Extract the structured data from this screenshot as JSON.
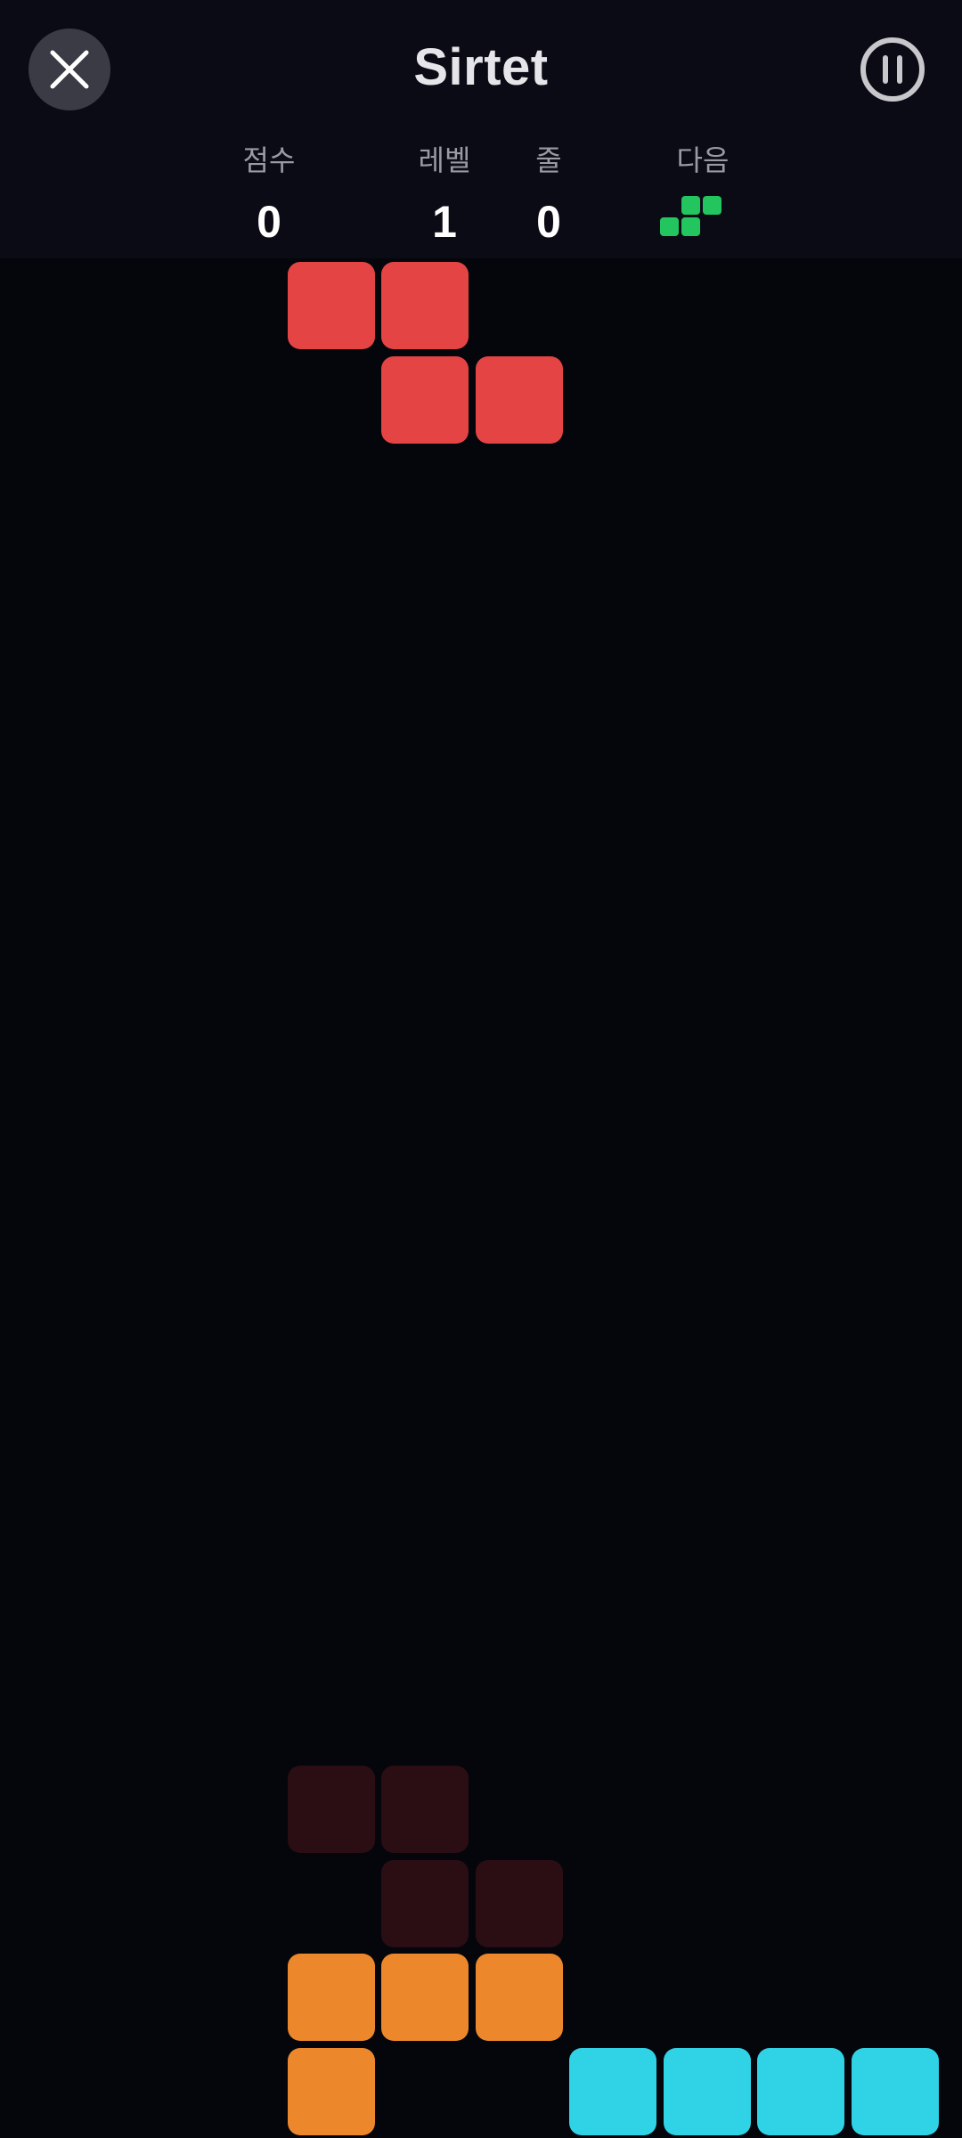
{
  "header": {
    "title": "Sirtet",
    "close_icon": "close-icon",
    "pause_icon": "pause-icon"
  },
  "stats": {
    "score_label": "점수",
    "score_value": "0",
    "level_label": "레벨",
    "level_value": "1",
    "lines_label": "줄",
    "lines_value": "0",
    "next_label": "다음"
  },
  "next_piece": {
    "type": "S",
    "color": "#22c55e",
    "cells": [
      [
        1,
        0
      ],
      [
        2,
        0
      ],
      [
        0,
        1
      ],
      [
        1,
        1
      ]
    ]
  },
  "board": {
    "columns": 10,
    "colors": {
      "Z": "#e44444",
      "ghost": "#2a0e14",
      "L": "#ec872b",
      "I": "#30d3e6"
    },
    "active_piece": {
      "type": "Z",
      "cells": [
        [
          3,
          0
        ],
        [
          4,
          0
        ],
        [
          4,
          1
        ],
        [
          5,
          1
        ]
      ]
    },
    "ghost_piece": {
      "cells": [
        [
          3,
          16
        ],
        [
          4,
          16
        ],
        [
          4,
          17
        ],
        [
          5,
          17
        ]
      ]
    },
    "locked": [
      {
        "type": "L",
        "cells": [
          [
            3,
            18
          ],
          [
            4,
            18
          ],
          [
            5,
            18
          ],
          [
            3,
            19
          ]
        ]
      },
      {
        "type": "I",
        "cells": [
          [
            6,
            19
          ],
          [
            7,
            19
          ],
          [
            8,
            19
          ],
          [
            9,
            19
          ]
        ]
      }
    ]
  }
}
